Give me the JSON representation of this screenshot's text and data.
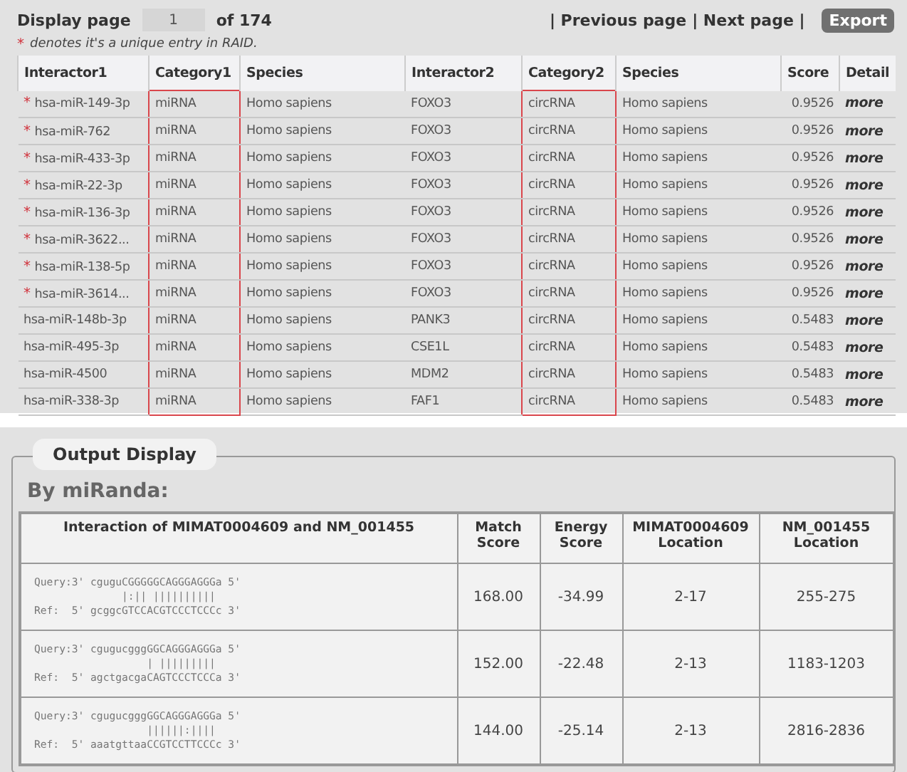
{
  "pager": {
    "label": "Display page",
    "page": "1",
    "of": "of 174",
    "links": [
      "| Previous page",
      "| Next page |"
    ],
    "export": "Export"
  },
  "note": {
    "mark": "*",
    "text": "denotes it's a unique entry in RAID."
  },
  "table": {
    "columns": [
      {
        "label": "Interactor1",
        "highlighted": false
      },
      {
        "label": "Category1",
        "highlighted": true
      },
      {
        "label": "Species",
        "highlighted": false
      },
      {
        "label": "Interactor2",
        "highlighted": false
      },
      {
        "label": "Category2",
        "highlighted": true
      },
      {
        "label": "Species",
        "highlighted": false
      },
      {
        "label": "Score",
        "highlighted": false
      },
      {
        "label": "Detail",
        "highlighted": false
      }
    ],
    "rows": [
      {
        "unique": true,
        "cells": [
          "hsa-miR-149-3p",
          "miRNA",
          "Homo sapiens",
          "FOXO3",
          "circRNA",
          "Homo sapiens",
          "0.9526",
          "more"
        ]
      },
      {
        "unique": true,
        "cells": [
          "hsa-miR-762",
          "miRNA",
          "Homo sapiens",
          "FOXO3",
          "circRNA",
          "Homo sapiens",
          "0.9526",
          "more"
        ]
      },
      {
        "unique": true,
        "cells": [
          "hsa-miR-433-3p",
          "miRNA",
          "Homo sapiens",
          "FOXO3",
          "circRNA",
          "Homo sapiens",
          "0.9526",
          "more"
        ]
      },
      {
        "unique": true,
        "cells": [
          "hsa-miR-22-3p",
          "miRNA",
          "Homo sapiens",
          "FOXO3",
          "circRNA",
          "Homo sapiens",
          "0.9526",
          "more"
        ]
      },
      {
        "unique": true,
        "cells": [
          "hsa-miR-136-3p",
          "miRNA",
          "Homo sapiens",
          "FOXO3",
          "circRNA",
          "Homo sapiens",
          "0.9526",
          "more"
        ]
      },
      {
        "unique": true,
        "cells": [
          "hsa-miR-3622...",
          "miRNA",
          "Homo sapiens",
          "FOXO3",
          "circRNA",
          "Homo sapiens",
          "0.9526",
          "more"
        ]
      },
      {
        "unique": true,
        "cells": [
          "hsa-miR-138-5p",
          "miRNA",
          "Homo sapiens",
          "FOXO3",
          "circRNA",
          "Homo sapiens",
          "0.9526",
          "more"
        ]
      },
      {
        "unique": true,
        "cells": [
          "hsa-miR-3614...",
          "miRNA",
          "Homo sapiens",
          "FOXO3",
          "circRNA",
          "Homo sapiens",
          "0.9526",
          "more"
        ]
      },
      {
        "unique": false,
        "cells": [
          "hsa-miR-148b-3p",
          "miRNA",
          "Homo sapiens",
          "PANK3",
          "circRNA",
          "Homo sapiens",
          "0.5483",
          "more"
        ]
      },
      {
        "unique": false,
        "cells": [
          "hsa-miR-495-3p",
          "miRNA",
          "Homo sapiens",
          "CSE1L",
          "circRNA",
          "Homo sapiens",
          "0.5483",
          "more"
        ]
      },
      {
        "unique": false,
        "cells": [
          "hsa-miR-4500",
          "miRNA",
          "Homo sapiens",
          "MDM2",
          "circRNA",
          "Homo sapiens",
          "0.5483",
          "more"
        ]
      },
      {
        "unique": false,
        "cells": [
          "hsa-miR-338-3p",
          "miRNA",
          "Homo sapiens",
          "FAF1",
          "circRNA",
          "Homo sapiens",
          "0.5483",
          "more"
        ]
      }
    ]
  },
  "output": {
    "legend": "Output Display",
    "heading": "By miRanda:",
    "columns": [
      "Interaction of MIMAT0004609 and NM_001455",
      "Match Score",
      "Energy Score",
      "MIMAT0004609 Location",
      "NM_001455 Location"
    ],
    "rows": [
      {
        "alignment": [
          "Query:3' cguguCGGGGGCAGGGAGGGa 5'",
          "              |:|| ||||||||||",
          "Ref:  5' gcggcGTCCACGTCCCTCCCc 3'"
        ],
        "match": "168.00",
        "energy": "-34.99",
        "loc1": "2-17",
        "loc2": "255-275"
      },
      {
        "alignment": [
          "Query:3' cgugucgggGGCAGGGAGGGa 5'",
          "                  | |||||||||",
          "Ref:  5' agctgacgaCAGTCCCTCCCa 3'"
        ],
        "match": "152.00",
        "energy": "-22.48",
        "loc1": "2-13",
        "loc2": "1183-1203"
      },
      {
        "alignment": [
          "Query:3' cgugucgggGGCAGGGAGGGa 5'",
          "                  ||||||:||||",
          "Ref:  5' aaatgttaaCCGTCCTTCCCc 3'"
        ],
        "match": "144.00",
        "energy": "-25.14",
        "loc1": "2-13",
        "loc2": "2816-2836"
      }
    ]
  }
}
